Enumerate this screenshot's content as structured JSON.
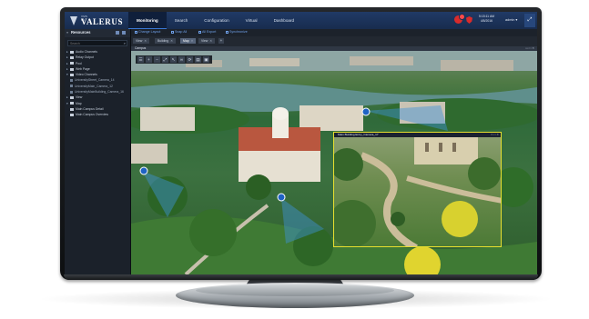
{
  "app": {
    "logo_small": "VMS BY",
    "logo_text": "VALERUS"
  },
  "topbar": {
    "tabs": [
      {
        "label": "Monitoring",
        "active": true
      },
      {
        "label": "Search",
        "active": false
      },
      {
        "label": "Configuration",
        "active": false
      },
      {
        "label": "Virtual",
        "active": false
      },
      {
        "label": "Dashboard",
        "active": false
      }
    ],
    "clock_time": "5:15:11 AM",
    "clock_date": "4/5/2016",
    "user_label": "admin ▾",
    "alert_icon": "alarm-bell-icon",
    "shield_icon": "security-shield-icon"
  },
  "sidebar": {
    "title": "Resources",
    "search_placeholder": "Search",
    "items": [
      {
        "label": "Audio Channels",
        "type": "folder",
        "level": 0
      },
      {
        "label": "Relay Output",
        "type": "folder",
        "level": 0
      },
      {
        "label": "Pool",
        "type": "folder",
        "level": 0
      },
      {
        "label": "Web Page",
        "type": "folder",
        "level": 0
      },
      {
        "label": "Video Channels",
        "type": "folder",
        "level": 0,
        "expanded": true
      },
      {
        "label": "UniversityStreet_Camera_14",
        "type": "camera",
        "level": 1
      },
      {
        "label": "UniversityMain_Camera_12",
        "type": "camera",
        "level": 1
      },
      {
        "label": "UniversityMainBuilding_Camera_16",
        "type": "camera",
        "level": 1
      },
      {
        "label": "View",
        "type": "folder",
        "level": 0
      },
      {
        "label": "Map",
        "type": "folder",
        "level": 0,
        "expanded": true
      },
      {
        "label": "Main Campus Detail",
        "type": "map",
        "level": 1
      },
      {
        "label": "Main Campus Overview",
        "type": "map",
        "level": 1
      }
    ]
  },
  "toolbar": {
    "items": [
      "Change Layout",
      "Snap All",
      "All Export",
      "Synchronize"
    ]
  },
  "panel_tabs": [
    {
      "label": "View",
      "active": false
    },
    {
      "label": "Building",
      "active": false
    },
    {
      "label": "Map",
      "active": true
    },
    {
      "label": "View",
      "active": false
    }
  ],
  "video": {
    "label": "Campus",
    "controls": "▭ □ ✕",
    "pip_label": "Main Building Entry_Camera_17",
    "pip_controls": "▭ □ ✕",
    "toolbar_icons": [
      "list-icon",
      "zoom-in-icon",
      "zoom-out-icon",
      "fit-icon",
      "pointer-icon",
      "link-icon",
      "rotate-icon",
      "layers-icon",
      "image-icon"
    ],
    "toolbar_glyphs": [
      "☰",
      "+",
      "−",
      "⤢",
      "↖",
      "∞",
      "⟳",
      "▤",
      "▣"
    ]
  },
  "colors": {
    "topbar": "#203a66",
    "accent": "#3a78d6",
    "pip_border": "#e7df2f",
    "alert": "#d92b2b"
  }
}
